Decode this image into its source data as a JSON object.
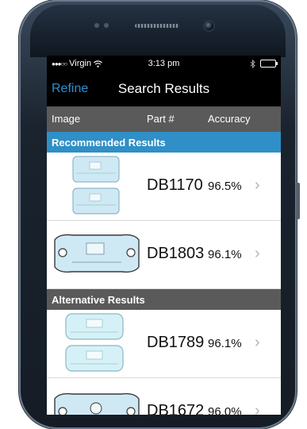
{
  "status_bar": {
    "signal": "●●●○○",
    "carrier": "Virgin",
    "wifi_icon": "wifi-icon",
    "time": "3:13 pm",
    "bluetooth_icon": "bluetooth-icon",
    "battery_icon": "battery-icon"
  },
  "nav": {
    "back_label": "Refine",
    "title": "Search Results"
  },
  "columns": {
    "image": "Image",
    "part": "Part #",
    "accuracy": "Accuracy"
  },
  "recommended": {
    "header": "Recommended Results",
    "items": [
      {
        "part": "DB1170",
        "accuracy": "96.5%",
        "chevron": "›"
      },
      {
        "part": "DB1803",
        "accuracy": "96.1%",
        "chevron": "›"
      }
    ]
  },
  "alternative": {
    "header": "Alternative Results",
    "items": [
      {
        "part": "DB1789",
        "accuracy": "96.1%",
        "chevron": "›"
      },
      {
        "part": "DB1672",
        "accuracy": "96.0%",
        "chevron": "›"
      }
    ]
  },
  "colors": {
    "accent": "#2e8fd2",
    "section_blue": "#2f8fc6",
    "header_gray": "#5a5a5a"
  }
}
